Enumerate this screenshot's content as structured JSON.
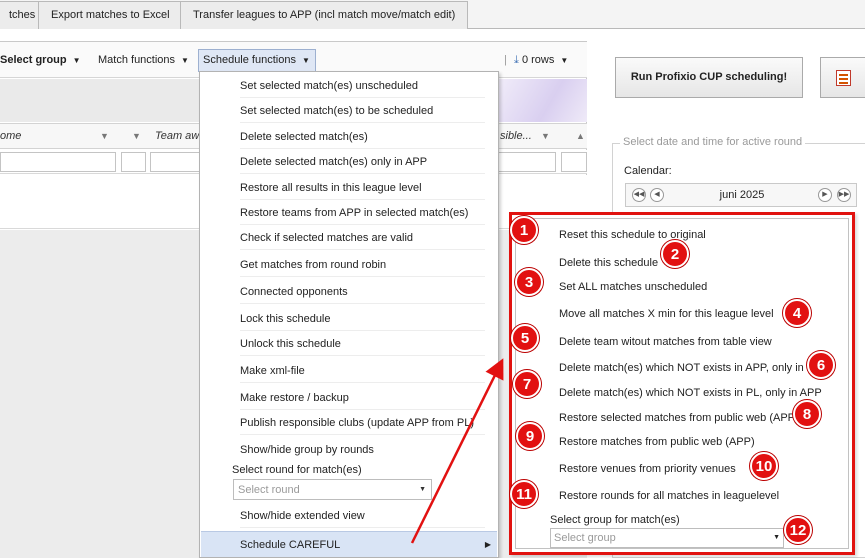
{
  "tabs": [
    "tches",
    "Export matches to Excel",
    "Transfer leagues to APP (incl match move/match edit)"
  ],
  "toolbar": {
    "select_group": "Select group",
    "match_functions": "Match functions",
    "schedule_functions": "Schedule functions",
    "rows": "0 rows"
  },
  "columns": {
    "home": "ome",
    "team_away": "Team aw",
    "responsible": "sible..."
  },
  "schedule_menu": {
    "items": [
      "Set selected match(es) unscheduled",
      "Set selected match(es) to be scheduled",
      "Delete selected match(es)",
      "Delete selected match(es) only in APP",
      "Restore all results in this league level",
      "Restore teams from APP in selected match(es)",
      "Check if selected matches are valid",
      "Get matches from round robin",
      "Connected opponents",
      "Lock this schedule",
      "Unlock this schedule",
      "Make xml-file",
      "Make restore / backup",
      "Publish responsible clubs (update APP from PL)",
      "Show/hide group by rounds"
    ],
    "round_label": "Select round for match(es)",
    "round_placeholder": "Select round",
    "extended_view": "Show/hide extended view",
    "careful": "Schedule CAREFUL"
  },
  "careful_menu": {
    "items": [
      "Reset this schedule to original",
      "Delete this schedule",
      "Set ALL matches unscheduled",
      "Move all matches X min for this league level",
      "Delete team witout matches from table view",
      "Delete match(es) which NOT exists in APP, only in PL",
      "Delete match(es) which NOT exists in PL, only in APP",
      "Restore selected matches from public web (APP)",
      "Restore matches from public web (APP)",
      "Restore venues from priority venues",
      "Restore rounds for all matches in leaguelevel"
    ],
    "group_label": "Select group for match(es)",
    "group_placeholder": "Select group"
  },
  "badges": [
    "1",
    "2",
    "3",
    "4",
    "5",
    "6",
    "7",
    "8",
    "9",
    "10",
    "11",
    "12"
  ],
  "right_panel": {
    "run_button": "Run Profixio CUP scheduling!",
    "legend": "Select date and time for active round",
    "calendar_label": "Calendar:",
    "month": "juni 2025"
  },
  "colors": {
    "annotation_red": "#e21111",
    "menu_highlight": "#d9e4f5"
  },
  "icons": [
    "filter-icon",
    "download-icon",
    "chevron-left-icon",
    "chevron-right-icon",
    "report-icon"
  ]
}
